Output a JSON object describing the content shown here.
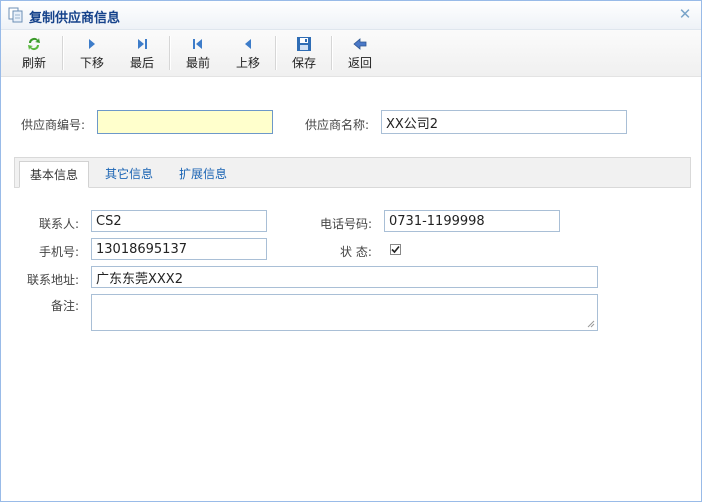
{
  "window": {
    "title": "复制供应商信息"
  },
  "toolbar": {
    "buttons": [
      {
        "label": "刷新",
        "icon": "refresh-icon"
      },
      {
        "label": "下移",
        "icon": "next-icon"
      },
      {
        "label": "最后",
        "icon": "last-icon"
      },
      {
        "label": "最前",
        "icon": "first-icon"
      },
      {
        "label": "上移",
        "icon": "previous-icon"
      },
      {
        "label": "保存",
        "icon": "save-icon"
      },
      {
        "label": "返回",
        "icon": "back-icon"
      }
    ]
  },
  "header_form": {
    "code_label": "供应商编号:",
    "code_value": "",
    "name_label": "供应商名称:",
    "name_value": "XX公司2"
  },
  "tabs": [
    {
      "label": "基本信息",
      "active": true
    },
    {
      "label": "其它信息",
      "active": false
    },
    {
      "label": "扩展信息",
      "active": false
    }
  ],
  "basic": {
    "contact_label": "联系人:",
    "contact_value": "CS2",
    "phone_label": "电话号码:",
    "phone_value": "0731-1199998",
    "mobile_label": "手机号:",
    "mobile_value": "13018695137",
    "status_label": "状 态:",
    "status_checked": true,
    "address_label": "联系地址:",
    "address_value": "广东东莞XXX2",
    "remark_label": "备注:",
    "remark_value": ""
  },
  "colors": {
    "title_text": "#15428b",
    "tab_link": "#1a64b4",
    "highlight_field": "#ffffcc"
  }
}
